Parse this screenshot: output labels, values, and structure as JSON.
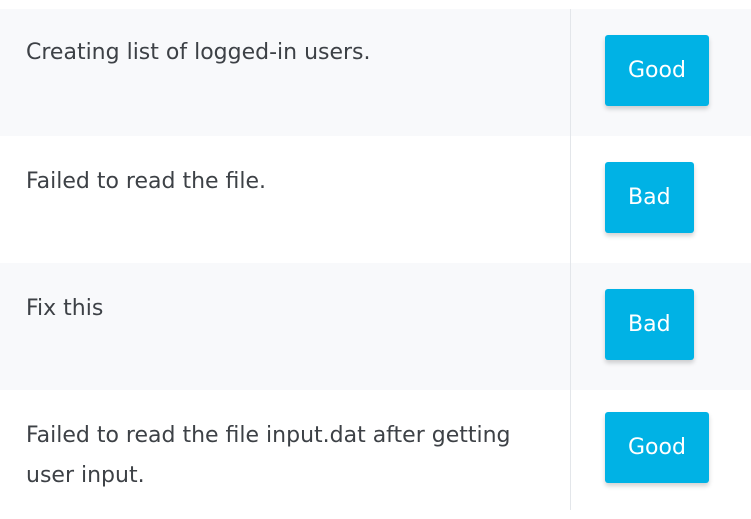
{
  "rows": [
    {
      "message": "Creating list of logged-in users.",
      "verdict": "Good"
    },
    {
      "message": "Failed to read the file.",
      "verdict": "Bad"
    },
    {
      "message": "Fix this",
      "verdict": "Bad"
    },
    {
      "message": "Failed to read the file input.dat after getting user input.",
      "verdict": "Good"
    }
  ],
  "colors": {
    "button": "#00b2e5",
    "row_alt_background": "#f8f9fb",
    "text": "#3d4146",
    "divider": "#e3e6ea"
  }
}
